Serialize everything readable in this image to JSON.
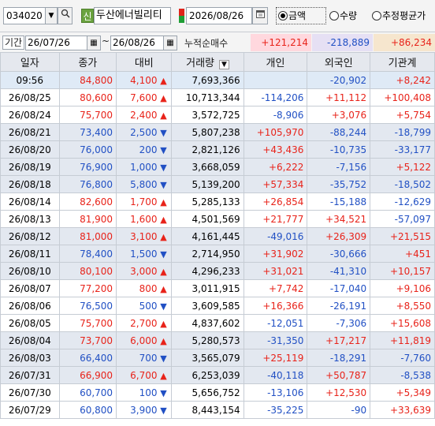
{
  "toolbar": {
    "stock_code": "034020",
    "code_dropdown_icon": "chevron-down-icon",
    "search_icon": "search-icon",
    "new_badge": "신",
    "stock_name": "두산에너빌리티",
    "date": "2026/08/26",
    "calendar_icon": "calendar-icon",
    "radio_options": [
      {
        "label": "금액",
        "selected": true
      },
      {
        "label": "수량",
        "selected": false
      },
      {
        "label": "추정평균가",
        "selected": false
      }
    ]
  },
  "period": {
    "label": "기간",
    "start_date": "26/07/26",
    "tilde": "~",
    "end_date": "26/08/26",
    "cumulative_label": "누적순매수",
    "sum_individual": "+121,214",
    "sum_foreign": "-218,889",
    "sum_institution": "+86,234"
  },
  "columns": [
    "일자",
    "종가",
    "대비",
    "거래량",
    "개인",
    "외국인",
    "기관계"
  ],
  "colors": {
    "up": "#e8231a",
    "down": "#2150c4",
    "header_bg": "#e5e8ee",
    "row_shade": "#e3e8f0"
  },
  "rows": [
    {
      "date": "09:56",
      "close": "84,800",
      "dir": "up",
      "change": "4,100",
      "volume": "7,693,366",
      "individual": "",
      "foreign": "-20,902",
      "institution": "+8,242"
    },
    {
      "date": "26/08/25",
      "close": "80,600",
      "dir": "up",
      "change": "7,600",
      "volume": "10,713,344",
      "individual": "-114,206",
      "foreign": "+11,112",
      "institution": "+100,408"
    },
    {
      "date": "26/08/24",
      "close": "75,700",
      "dir": "up",
      "change": "2,400",
      "volume": "3,572,725",
      "individual": "-8,906",
      "foreign": "+3,076",
      "institution": "+5,754"
    },
    {
      "date": "26/08/21",
      "close": "73,400",
      "dir": "down",
      "change": "2,500",
      "volume": "5,807,238",
      "individual": "+105,970",
      "foreign": "-88,244",
      "institution": "-18,799"
    },
    {
      "date": "26/08/20",
      "close": "76,000",
      "dir": "down",
      "change": "200",
      "volume": "2,821,126",
      "individual": "+43,436",
      "foreign": "-10,735",
      "institution": "-33,177"
    },
    {
      "date": "26/08/19",
      "close": "76,900",
      "dir": "down",
      "change": "1,000",
      "volume": "3,668,059",
      "individual": "+6,222",
      "foreign": "-7,156",
      "institution": "+5,122"
    },
    {
      "date": "26/08/18",
      "close": "76,800",
      "dir": "down",
      "change": "5,800",
      "volume": "5,139,200",
      "individual": "+57,334",
      "foreign": "-35,752",
      "institution": "-18,502"
    },
    {
      "date": "26/08/14",
      "close": "82,600",
      "dir": "up",
      "change": "1,700",
      "volume": "5,285,133",
      "individual": "+26,854",
      "foreign": "-15,188",
      "institution": "-12,629"
    },
    {
      "date": "26/08/13",
      "close": "81,900",
      "dir": "up",
      "change": "1,600",
      "volume": "4,501,569",
      "individual": "+21,777",
      "foreign": "+34,521",
      "institution": "-57,097"
    },
    {
      "date": "26/08/12",
      "close": "81,000",
      "dir": "up",
      "change": "3,100",
      "volume": "4,161,445",
      "individual": "-49,016",
      "foreign": "+26,309",
      "institution": "+21,515"
    },
    {
      "date": "26/08/11",
      "close": "78,400",
      "dir": "down",
      "change": "1,500",
      "volume": "2,714,950",
      "individual": "+31,902",
      "foreign": "-30,666",
      "institution": "+451"
    },
    {
      "date": "26/08/10",
      "close": "80,100",
      "dir": "up",
      "change": "3,000",
      "volume": "4,296,233",
      "individual": "+31,021",
      "foreign": "-41,310",
      "institution": "+10,157"
    },
    {
      "date": "26/08/07",
      "close": "77,200",
      "dir": "up",
      "change": "800",
      "volume": "3,011,915",
      "individual": "+7,742",
      "foreign": "-17,040",
      "institution": "+9,106"
    },
    {
      "date": "26/08/06",
      "close": "76,500",
      "dir": "down",
      "change": "500",
      "volume": "3,609,585",
      "individual": "+16,366",
      "foreign": "-26,191",
      "institution": "+8,550"
    },
    {
      "date": "26/08/05",
      "close": "75,700",
      "dir": "up",
      "change": "2,700",
      "volume": "4,837,602",
      "individual": "-12,051",
      "foreign": "-7,306",
      "institution": "+15,608"
    },
    {
      "date": "26/08/04",
      "close": "73,700",
      "dir": "up",
      "change": "6,000",
      "volume": "5,280,573",
      "individual": "-31,350",
      "foreign": "+17,217",
      "institution": "+11,819"
    },
    {
      "date": "26/08/03",
      "close": "66,400",
      "dir": "down",
      "change": "700",
      "volume": "3,565,079",
      "individual": "+25,119",
      "foreign": "-18,291",
      "institution": "-7,760"
    },
    {
      "date": "26/07/31",
      "close": "66,900",
      "dir": "up",
      "change": "6,700",
      "volume": "6,253,039",
      "individual": "-40,118",
      "foreign": "+50,787",
      "institution": "-8,538"
    },
    {
      "date": "26/07/30",
      "close": "60,700",
      "dir": "down",
      "change": "100",
      "volume": "5,656,752",
      "individual": "-13,106",
      "foreign": "+12,530",
      "institution": "+5,349"
    },
    {
      "date": "26/07/29",
      "close": "60,800",
      "dir": "down",
      "change": "3,900",
      "volume": "8,443,154",
      "individual": "-35,225",
      "foreign": "-90",
      "institution": "+33,639"
    }
  ]
}
